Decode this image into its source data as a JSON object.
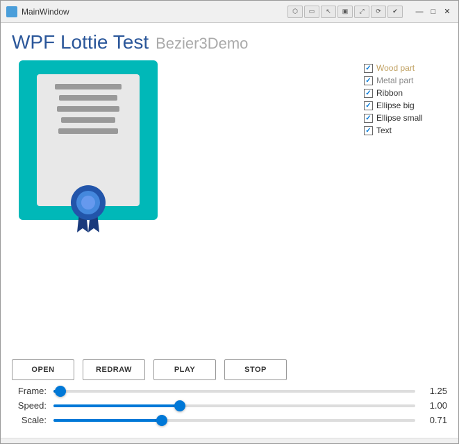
{
  "window": {
    "title": "MainWindow",
    "close_label": "✕",
    "minimize_label": "—",
    "maximize_label": "□"
  },
  "app_title": {
    "main": "WPF Lottie Test",
    "sub": "Bezier3Demo"
  },
  "legend": {
    "items": [
      {
        "id": "wood-part",
        "label": "Wood part",
        "checked": true,
        "color_class": "wood"
      },
      {
        "id": "metal-part",
        "label": "Metal part",
        "checked": true,
        "color_class": "metal"
      },
      {
        "id": "ribbon",
        "label": "Ribbon",
        "checked": true,
        "color_class": "ribbon"
      },
      {
        "id": "ellipse-big",
        "label": "Ellipse big",
        "checked": true,
        "color_class": "ellipse-big"
      },
      {
        "id": "ellipse-small",
        "label": "Ellipse small",
        "checked": true,
        "color_class": "ellipse-small"
      },
      {
        "id": "text",
        "label": "Text",
        "checked": true,
        "color_class": "text"
      }
    ]
  },
  "buttons": {
    "open": "OPEN",
    "redraw": "REDRAW",
    "play": "PLAY",
    "stop": "STOP"
  },
  "sliders": {
    "frame": {
      "label": "Frame:",
      "value": "1.25",
      "percent": 2
    },
    "speed": {
      "label": "Speed:",
      "value": "1.00",
      "percent": 35
    },
    "scale": {
      "label": "Scale:",
      "value": "0.71",
      "percent": 30
    }
  },
  "toolbar_buttons": [
    "⬡",
    "▭",
    "↖",
    "▣",
    "⤢",
    "⟳",
    "✔"
  ]
}
